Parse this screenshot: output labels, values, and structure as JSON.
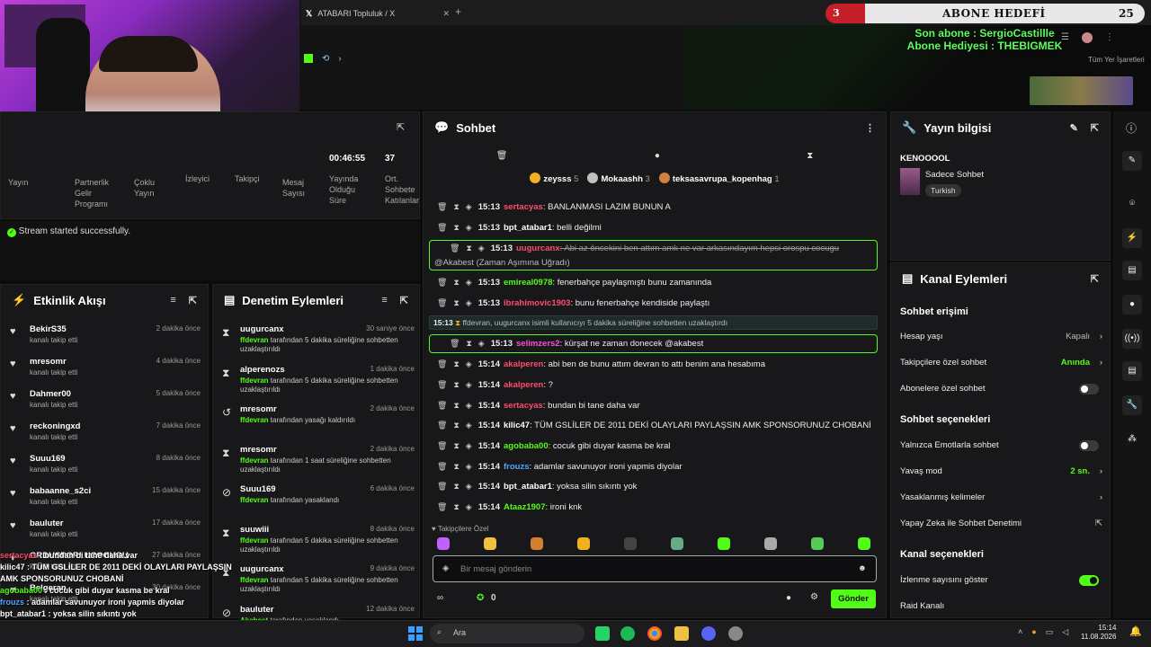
{
  "browser": {
    "tab_title": "ATABARI Topluluk / X",
    "bookmarks": "Tüm Yer İşaretleri"
  },
  "overlay": {
    "abone_count": "3",
    "abone_title": "ABONE HEDEFİ",
    "abone_goal": "25",
    "son_abone": "Son abone : SergioCastillle",
    "abone_hediyesi": "Abone Hediyesi : THEBIGMEK"
  },
  "stats": {
    "labels": [
      "Yayın",
      "Partnerlik Gelir Programı",
      "Çoklu Yayın",
      "İzleyici",
      "Takipçi",
      "Mesaj Sayısı"
    ],
    "duration": "00:46:55",
    "duration_label": "Yayında Olduğu Süre",
    "avg": "37",
    "avg_label": "Ort. Sohbete Katılanlar"
  },
  "stream_status": "Stream started successfully.",
  "activity": {
    "title": "Etkinlik Akışı",
    "items": [
      {
        "name": "BekirS35",
        "sub": "kanalı takip etti",
        "time": "2 dakika önce"
      },
      {
        "name": "mresomr",
        "sub": "kanalı takip etti",
        "time": "4 dakika önce"
      },
      {
        "name": "Dahmer00",
        "sub": "kanalı takip etti",
        "time": "5 dakika önce"
      },
      {
        "name": "reckoningxd",
        "sub": "kanalı takip etti",
        "time": "7 dakika önce"
      },
      {
        "name": "Suuu169",
        "sub": "kanalı takip etti",
        "time": "8 dakika önce"
      },
      {
        "name": "babaanne_s2ci",
        "sub": "kanalı takip etti",
        "time": "15 dakika önce"
      },
      {
        "name": "bauluter",
        "sub": "kanalı takip etti",
        "time": "17 dakika önce"
      },
      {
        "name": "ORDUSPORLUCOCUGU",
        "sub": "kanalı takip etti",
        "time": "27 dakika önce"
      },
      {
        "name": "Belgeran",
        "sub": "kanalı takip etti",
        "time": "30 dakika önce"
      }
    ]
  },
  "moderation": {
    "title": "Denetim Eylemleri",
    "items": [
      {
        "name": "uugurcanx",
        "mod": "ffdevran",
        "sub": " tarafından 5 dakika süreliğine sohbetten uzaklaştırıldı",
        "time": "30 saniye önce",
        "icon": "⧗"
      },
      {
        "name": "alperenozs",
        "mod": "ffdevran",
        "sub": " tarafından 5 dakika süreliğine sohbetten uzaklaştırıldı",
        "time": "1 dakika önce",
        "icon": "⧗"
      },
      {
        "name": "mresomr",
        "mod": "ffdevran",
        "sub": " tarafından yasağı kaldırıldı",
        "time": "2 dakika önce",
        "icon": "↺"
      },
      {
        "name": "mresomr",
        "mod": "ffdevran",
        "sub": " tarafından 1 saat süreliğine sohbetten uzaklaştırıldı",
        "time": "2 dakika önce",
        "icon": "⧗"
      },
      {
        "name": "Suuu169",
        "mod": "ffdevran",
        "sub": " tarafından yasaklandı",
        "time": "6 dakika önce",
        "icon": "⊘"
      },
      {
        "name": "suuwiii",
        "mod": "ffdevran",
        "sub": " tarafından 5 dakika süreliğine sohbetten uzaklaştırıldı",
        "time": "8 dakika önce",
        "icon": "⧗"
      },
      {
        "name": "uugurcanx",
        "mod": "ffdevran",
        "sub": " tarafından 5 dakika süreliğine sohbetten uzaklaştırıldı",
        "time": "9 dakika önce",
        "icon": "⧗"
      },
      {
        "name": "bauluter",
        "mod": "Akabest",
        "sub": " tarafından yasaklandı",
        "time": "12 dakika önce",
        "icon": "⊘"
      }
    ]
  },
  "overlay_chat": [
    {
      "user": "sertacyas",
      "text": " : bundan bi tane daha var",
      "color": "#ff4d6d"
    },
    {
      "user": "kilic47",
      "text": " : TÜM GSLİLER DE 2011 DEKİ OLAYLARI PAYLAŞSIN AMK SPONSORUNUZ CHOBANİ",
      "color": "#ffffff"
    },
    {
      "user": "agobaba00",
      "text": " : cocuk gibi duyar kasma be kral",
      "color": "#53fc18"
    },
    {
      "user": "frouzs",
      "text": " : adamlar savunuyor ironi yapmis diyolar",
      "color": "#4da6ff"
    },
    {
      "user": "bpt_atabar1",
      "text": " : yoksa silin sıkıntı yok",
      "color": "#ffffff"
    },
    {
      "user": "Ataaz1907",
      "text": " : ironi knk",
      "color": "#ffffff"
    }
  ],
  "chat": {
    "title": "Sohbet",
    "leaders": [
      {
        "name": "zeysss",
        "count": "5",
        "color": "#f0b020"
      },
      {
        "name": "Mokaashh",
        "count": "3",
        "color": "#c0c0c0"
      },
      {
        "name": "teksasavrupa_kopenhag",
        "count": "1",
        "color": "#d08040"
      }
    ],
    "messages": [
      {
        "time": "15:13",
        "user": "sertacyas",
        "ucolor": "#ff4d6d",
        "text": ": BANLANMASI LAZIM BUNUN A"
      },
      {
        "time": "15:13",
        "user": "bpt_atabar1",
        "ucolor": "#ffffff",
        "text": ": belli değilmi"
      },
      {
        "time": "15:13",
        "user": "uugurcanx",
        "ucolor": "#ff4d6d",
        "text": ": Abi az öncekini ben attım amk ne var arkasındayım hepsi orospu cocugu"
      },
      {
        "time": "15:13",
        "user": "emireal0978",
        "ucolor": "#53fc18",
        "text": ": fenerbahçe paylaşmıştı bunu zamanında"
      },
      {
        "time": "15:13",
        "user": "ibrahimovic1903",
        "ucolor": "#ff4d6d",
        "text": ": bunu fenerbahçe kendiside paylaştı"
      },
      {
        "time": "15:13",
        "user": "selimzers2",
        "ucolor": "#ff4dd2",
        "text": ": kürşat ne zaman donecek @akabest"
      },
      {
        "time": "15:14",
        "user": "akalperen",
        "ucolor": "#ff4d6d",
        "text": ": abi ben de bunu attım devran to attı benim ana hesabıma"
      },
      {
        "time": "15:14",
        "user": "akalperen",
        "ucolor": "#ff4d6d",
        "text": ": ?"
      },
      {
        "time": "15:14",
        "user": "sertacyas",
        "ucolor": "#ff4d6d",
        "text": ": bundan bi tane daha var"
      },
      {
        "time": "15:14",
        "user": "kilic47",
        "ucolor": "#ffffff",
        "text": ": TÜM GSLİLER DE 2011 DEKİ OLAYLARI PAYLAŞSIN AMK SPONSORUNUZ CHOBANİ"
      },
      {
        "time": "15:14",
        "user": "agobaba00",
        "ucolor": "#53fc18",
        "text": ": cocuk gibi duyar kasma be kral"
      },
      {
        "time": "15:14",
        "user": "frouzs",
        "ucolor": "#4da6ff",
        "text": ": adamlar savunuyor ironi yapmis diyolar"
      },
      {
        "time": "15:14",
        "user": "bpt_atabar1",
        "ucolor": "#ffffff",
        "text": ": yoksa silin sıkıntı yok"
      },
      {
        "time": "15:14",
        "user": "Ataaz1907",
        "ucolor": "#53fc18",
        "text": ": ironi knk"
      }
    ],
    "timeout_note": "@Akabest (Zaman Aşımına Uğradı)",
    "system_time": "15:13",
    "system_text": "ffdevran, uugurcanx isimli kullanıcıyı 5 dakika süreliğine sohbetten uzaklaştırdı",
    "emote_label": "♥ Takipçilere Özel",
    "input_placeholder": "Bir mesaj gönderin",
    "points": "0",
    "send_label": "Gönder"
  },
  "yayin": {
    "title": "Yayın bilgisi",
    "stream_title": "KENOOOOL",
    "category": "Sadece Sohbet",
    "tag": "Turkish"
  },
  "kanal": {
    "title": "Kanal Eylemleri",
    "sohbet_erisimi": "Sohbet erişimi",
    "hesap_yasi": "Hesap yaşı",
    "hesap_yasi_val": "Kapalı",
    "takipci_ozel": "Takipçilere özel sohbet",
    "takipci_ozel_val": "Anında",
    "abone_ozel": "Abonelere özel sohbet",
    "sohbet_secenekleri": "Sohbet seçenekleri",
    "emote_only": "Yalnızca Emotlarla sohbet",
    "yavas_mod": "Yavaş mod",
    "yavas_mod_val": "2 sn.",
    "yasakli": "Yasaklanmış kelimeler",
    "yapay_zeka": "Yapay Zeka ile Sohbet Denetimi",
    "kanal_secenekleri": "Kanal seçenekleri",
    "izlenme": "İzlenme sayısını göster",
    "raid": "Raid Kanalı"
  },
  "taskbar": {
    "search": "Ara",
    "time": "15:14",
    "date": "11.08.2026"
  }
}
